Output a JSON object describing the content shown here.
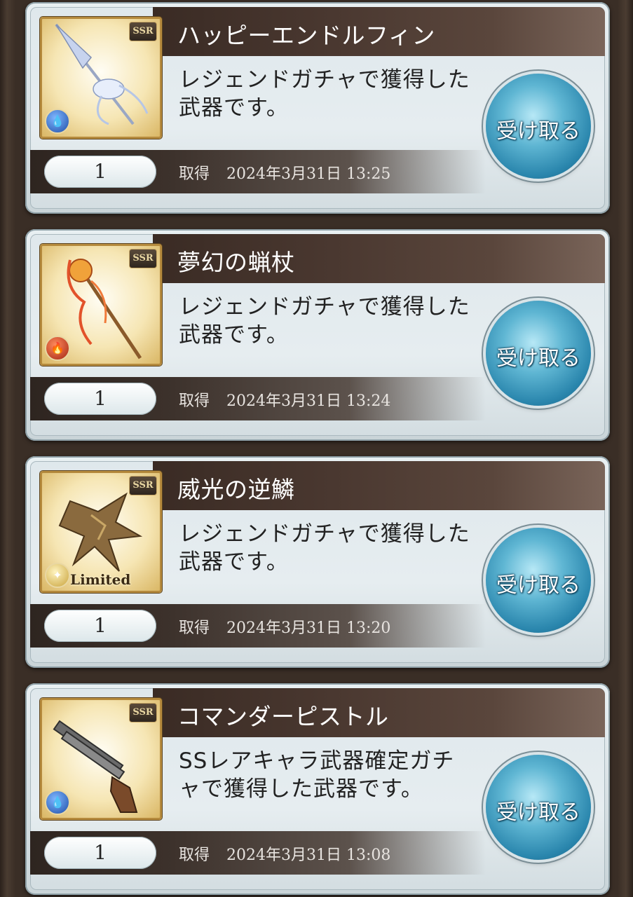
{
  "cards": [
    {
      "name": "ハッピーエンドルフィン",
      "description": "レジェンドガチャで獲得した武器です。",
      "count": "1",
      "acquired_label": "取得",
      "acquired_date": "2024年3月31日 13:25",
      "rarity": "SSR",
      "element": "water-icon",
      "limited": "",
      "button": "受け取る"
    },
    {
      "name": "夢幻の蝋杖",
      "description": "レジェンドガチャで獲得した武器です。",
      "count": "1",
      "acquired_label": "取得",
      "acquired_date": "2024年3月31日 13:24",
      "rarity": "SSR",
      "element": "fire-icon",
      "limited": "",
      "button": "受け取る"
    },
    {
      "name": "威光の逆鱗",
      "description": "レジェンドガチャで獲得した武器です。",
      "count": "1",
      "acquired_label": "取得",
      "acquired_date": "2024年3月31日 13:20",
      "rarity": "SSR",
      "element": "light-icon",
      "limited": "Limited",
      "button": "受け取る"
    },
    {
      "name": "コマンダーピストル",
      "description": "SSレアキャラ武器確定ガチャで獲得した武器です。",
      "count": "1",
      "acquired_label": "取得",
      "acquired_date": "2024年3月31日 13:08",
      "rarity": "SSR",
      "element": "water-icon",
      "limited": "",
      "button": "受け取る"
    }
  ]
}
